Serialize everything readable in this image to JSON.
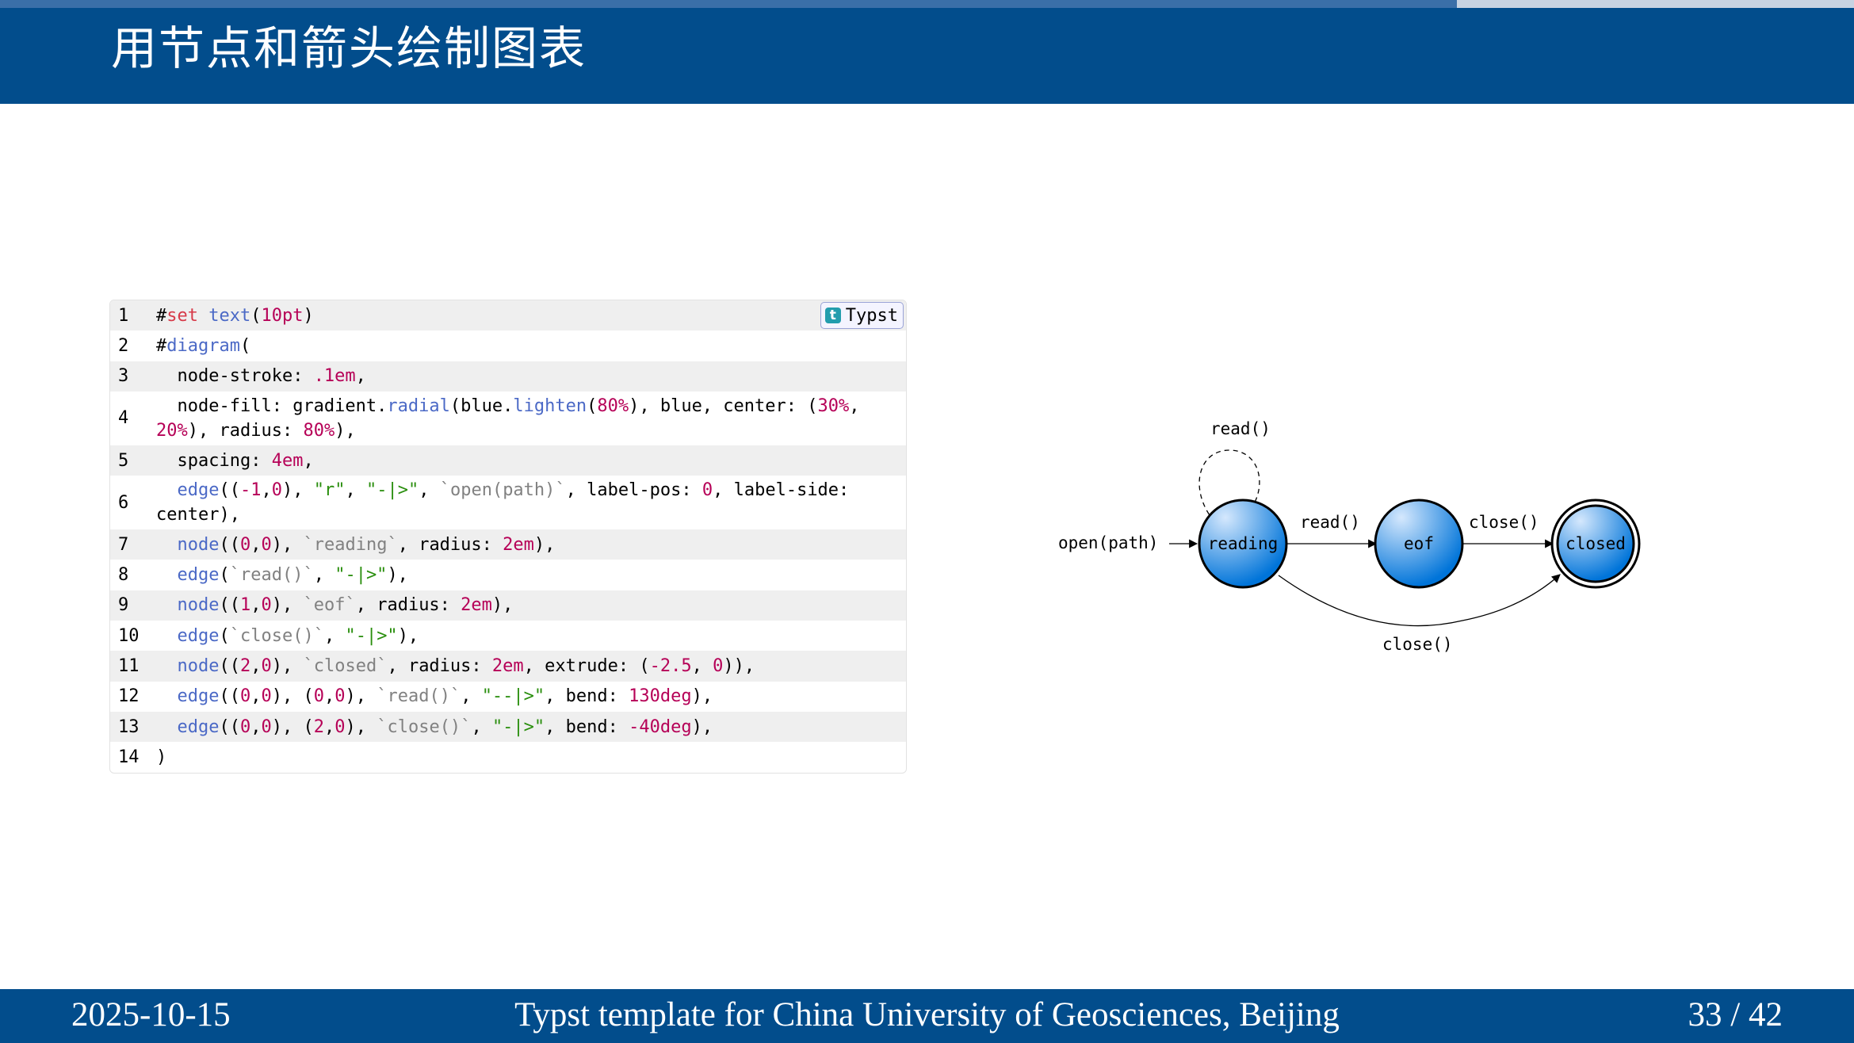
{
  "slide": {
    "title": "用节点和箭头绘制图表",
    "progress": 0.786
  },
  "footer": {
    "date": "2025-10-15",
    "center": "Typst template for China University of Geosciences, Beijing",
    "page": "33 / 42"
  },
  "code": {
    "language": "Typst",
    "lines": [
      {
        "n": "1",
        "text": "#set text(10pt)"
      },
      {
        "n": "2",
        "text": "#diagram("
      },
      {
        "n": "3",
        "text": "  node-stroke: .1em,"
      },
      {
        "n": "4",
        "text": "  node-fill: gradient.radial(blue.lighten(80%), blue, center: (30%, 20%), radius: 80%),"
      },
      {
        "n": "5",
        "text": "  spacing: 4em,"
      },
      {
        "n": "6",
        "text": "  edge((-1,0), \"r\", \"-|>\", `open(path)`, label-pos: 0, label-side: center),"
      },
      {
        "n": "7",
        "text": "  node((0,0), `reading`, radius: 2em),"
      },
      {
        "n": "8",
        "text": "  edge(`read()`, \"-|>\"),"
      },
      {
        "n": "9",
        "text": "  node((1,0), `eof`, radius: 2em),"
      },
      {
        "n": "10",
        "text": "  edge(`close()`, \"-|>\"),"
      },
      {
        "n": "11",
        "text": "  node((2,0), `closed`, radius: 2em, extrude: (-2.5, 0)),"
      },
      {
        "n": "12",
        "text": "  edge((0,0), (0,0), `read()`, \"--|>\", bend: 130deg),"
      },
      {
        "n": "13",
        "text": "  edge((0,0), (2,0), `close()`, \"-|>\", bend: -40deg),"
      },
      {
        "n": "14",
        "text": ")"
      }
    ]
  },
  "diagram": {
    "nodes": {
      "reading": "reading",
      "eof": "eof",
      "closed": "closed"
    },
    "edges": {
      "open": "open(path)",
      "read_loop": "read()",
      "read": "read()",
      "close": "close()",
      "close_bend": "close()"
    },
    "colors": {
      "node_light": "#d5e8fd",
      "node_dark": "#0074d9",
      "stroke": "#000000"
    }
  },
  "colors": {
    "header_bg": "#024d8c",
    "progress_fill": "#3a6fa8",
    "progress_track": "#c7d3e2"
  }
}
